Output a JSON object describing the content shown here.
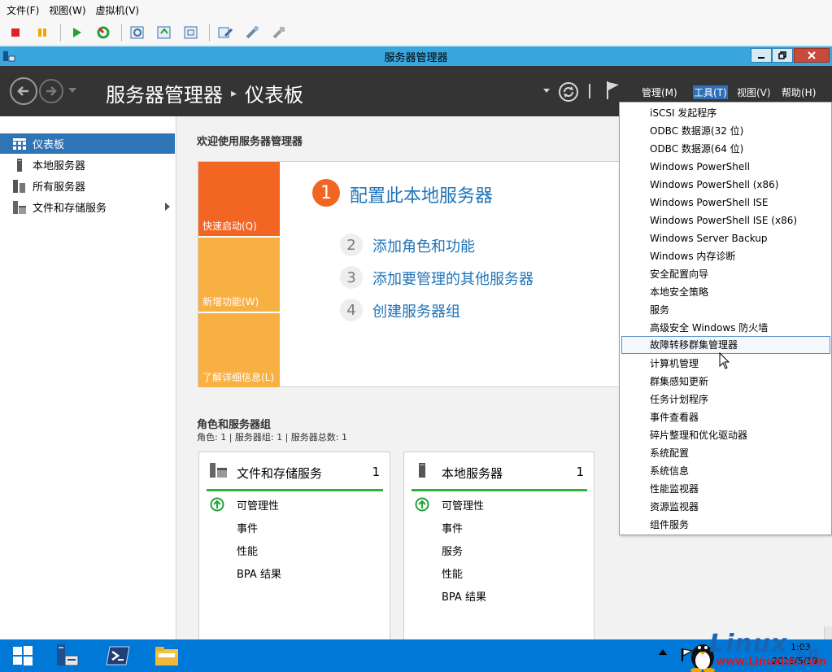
{
  "vm_menubar": {
    "items": [
      "文件(F)",
      "视图(W)",
      "虚拟机(V)"
    ]
  },
  "vm_toolbar": {
    "icons": [
      "stop-icon",
      "pause-icon",
      "play-icon",
      "reset-icon",
      "snapshot-icon",
      "revert-icon",
      "manage-snapshots-icon",
      "ctrl-alt-del-icon",
      "settings-icon",
      "tools-icon"
    ],
    "colors": {
      "stop": "#e0202a",
      "pause": "#f0a800",
      "play": "#21a336"
    }
  },
  "window": {
    "title": "服务器管理器",
    "accent": "#3aa6de"
  },
  "header": {
    "breadcrumb": [
      "服务器管理器",
      "仪表板"
    ],
    "menus": {
      "manage": "管理(M)",
      "tools": "工具(T)",
      "view": "视图(V)",
      "help": "帮助(H)"
    },
    "pipe": "|"
  },
  "sidebar": {
    "items": [
      {
        "label": "仪表板",
        "icon": "dashboard-icon",
        "selected": true
      },
      {
        "label": "本地服务器",
        "icon": "server-icon"
      },
      {
        "label": "所有服务器",
        "icon": "servers-icon"
      },
      {
        "label": "文件和存储服务",
        "icon": "file-storage-icon"
      }
    ]
  },
  "welcome": {
    "heading": "欢迎使用服务器管理器",
    "tiles": [
      "快速启动(Q)",
      "新增功能(W)",
      "了解详细信息(L)"
    ],
    "steps": [
      {
        "num": "1",
        "label": "配置此本地服务器"
      },
      {
        "num": "2",
        "label": "添加角色和功能"
      },
      {
        "num": "3",
        "label": "添加要管理的其他服务器"
      },
      {
        "num": "4",
        "label": "创建服务器组"
      }
    ]
  },
  "roles": {
    "heading": "角色和服务器组",
    "summary": "角色: 1 | 服务器组: 1 | 服务器总数: 1",
    "cards": [
      {
        "title": "文件和存储服务",
        "count": "1",
        "rows": [
          "可管理性",
          "事件",
          "性能",
          "BPA 结果"
        ]
      },
      {
        "title": "本地服务器",
        "count": "1",
        "rows": [
          "可管理性",
          "事件",
          "服务",
          "性能",
          "BPA 结果"
        ]
      }
    ]
  },
  "tools_menu": {
    "items": [
      "iSCSI 发起程序",
      "ODBC 数据源(32 位)",
      "ODBC 数据源(64 位)",
      "Windows PowerShell",
      "Windows PowerShell (x86)",
      "Windows PowerShell ISE",
      "Windows PowerShell ISE (x86)",
      "Windows Server Backup",
      "Windows 内存诊断",
      "安全配置向导",
      "本地安全策略",
      "服务",
      "高级安全 Windows 防火墙",
      "故障转移群集管理器",
      "计算机管理",
      "群集感知更新",
      "任务计划程序",
      "事件查看器",
      "碎片整理和优化驱动器",
      "系统配置",
      "系统信息",
      "性能监视器",
      "资源监视器",
      "组件服务"
    ],
    "highlighted_index": 13
  },
  "taskbar": {
    "clock_time": "1:03",
    "clock_date": "2016/5/19",
    "accent": "#0078d7"
  },
  "watermark": {
    "brand": "Linux",
    "suffix": "公社",
    "url": "www.Linuxidc.com"
  }
}
